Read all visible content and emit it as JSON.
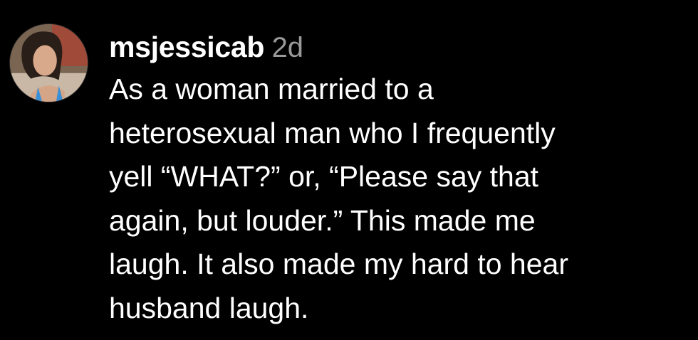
{
  "comment": {
    "username": "msjessicab",
    "timestamp": "2d",
    "avatar_alt": "profile photo",
    "text_lines": [
      "As a woman married to a",
      "heterosexual man who I frequently",
      "yell “WHAT?” or, “Please say that",
      "again, but louder.” This made me",
      "laugh. It also made my hard to hear",
      "husband laugh."
    ]
  },
  "colors": {
    "background": "#000000",
    "text": "#ffffff",
    "timestamp": "#9a9a9a"
  }
}
